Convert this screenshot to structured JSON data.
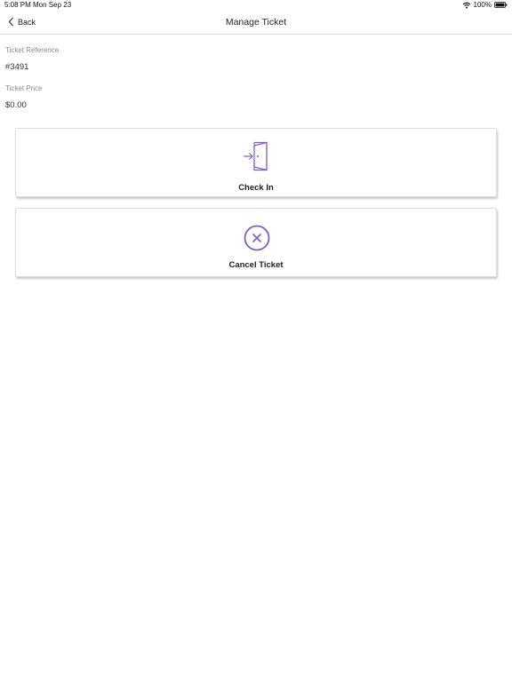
{
  "status_bar": {
    "time": "5:08 PM",
    "date": "Mon Sep 23",
    "battery": "100%",
    "icons": [
      "wifi-icon",
      "battery-icon"
    ]
  },
  "nav": {
    "back_label": "Back",
    "title": "Manage Ticket",
    "back_icon": "chevron-left-icon"
  },
  "fields": {
    "reference": {
      "label": "Ticket Reference",
      "value": "#3491"
    },
    "price": {
      "label": "Ticket Price",
      "value": "$0.00"
    }
  },
  "actions": {
    "check_in": {
      "label": "Check In",
      "icon": "door-enter-icon"
    },
    "cancel": {
      "label": "Cancel Ticket",
      "icon": "cancel-circle-icon"
    }
  },
  "colors": {
    "accent": "#7b5fc9",
    "divider": "#d9d9d9",
    "label_gray": "#8a8a8a"
  }
}
